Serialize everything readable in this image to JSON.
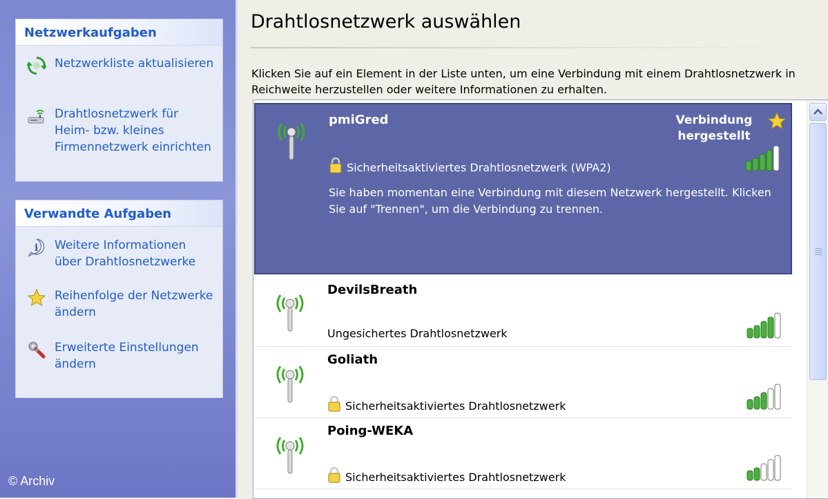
{
  "left_pane": {
    "network_tasks": {
      "title": "Netzwerkaufgaben",
      "items": [
        {
          "label": "Netzwerkliste aktualisieren",
          "icon": "refresh-icon"
        },
        {
          "label": "Drahtlosnetzwerk für Heim- bzw. kleines Firmennetzwerk einrichten",
          "icon": "wireless-setup-icon"
        }
      ]
    },
    "related_tasks": {
      "title": "Verwandte Aufgaben",
      "items": [
        {
          "label": "Weitere Informationen über Drahtlosnetzwerke",
          "icon": "info-icon"
        },
        {
          "label": "Reihenfolge der Netzwerke ändern",
          "icon": "star-icon"
        },
        {
          "label": "Erweiterte Einstellungen ändern",
          "icon": "wrench-icon"
        }
      ]
    },
    "copyright": "© Archiv"
  },
  "main": {
    "title": "Drahtlosnetzwerk auswählen",
    "intro": "Klicken Sie auf ein Element in der Liste unten, um eine Verbindung mit einem Drahtlosnetzwerk in Reichweite herzustellen oder weitere Informationen zu erhalten.",
    "networks": [
      {
        "name": "pmiGred",
        "security": "Sicherheitsaktiviertes Drahtlosnetzwerk (WPA2)",
        "secured": true,
        "status": "Verbindung hergestellt",
        "description": "Sie haben momentan eine Verbindung mit diesem Netzwerk hergestellt. Klicken Sie auf \"Trennen\", um die Verbindung zu trennen.",
        "signal": 4,
        "selected": true
      },
      {
        "name": "DevilsBreath",
        "security": "Ungesichertes Drahtlosnetzwerk",
        "secured": false,
        "signal": 4
      },
      {
        "name": "Goliath",
        "security": "Sicherheitsaktiviertes Drahtlosnetzwerk",
        "secured": true,
        "signal": 3
      },
      {
        "name": "Poing-WEKA",
        "security": "Sicherheitsaktiviertes Drahtlosnetzwerk",
        "secured": true,
        "signal": 2
      }
    ]
  },
  "colors": {
    "task_link": "#215dc6",
    "selected_row": "#5d67a8",
    "signal_green": "#4caf3e",
    "antenna_green": "#3fae2a"
  }
}
